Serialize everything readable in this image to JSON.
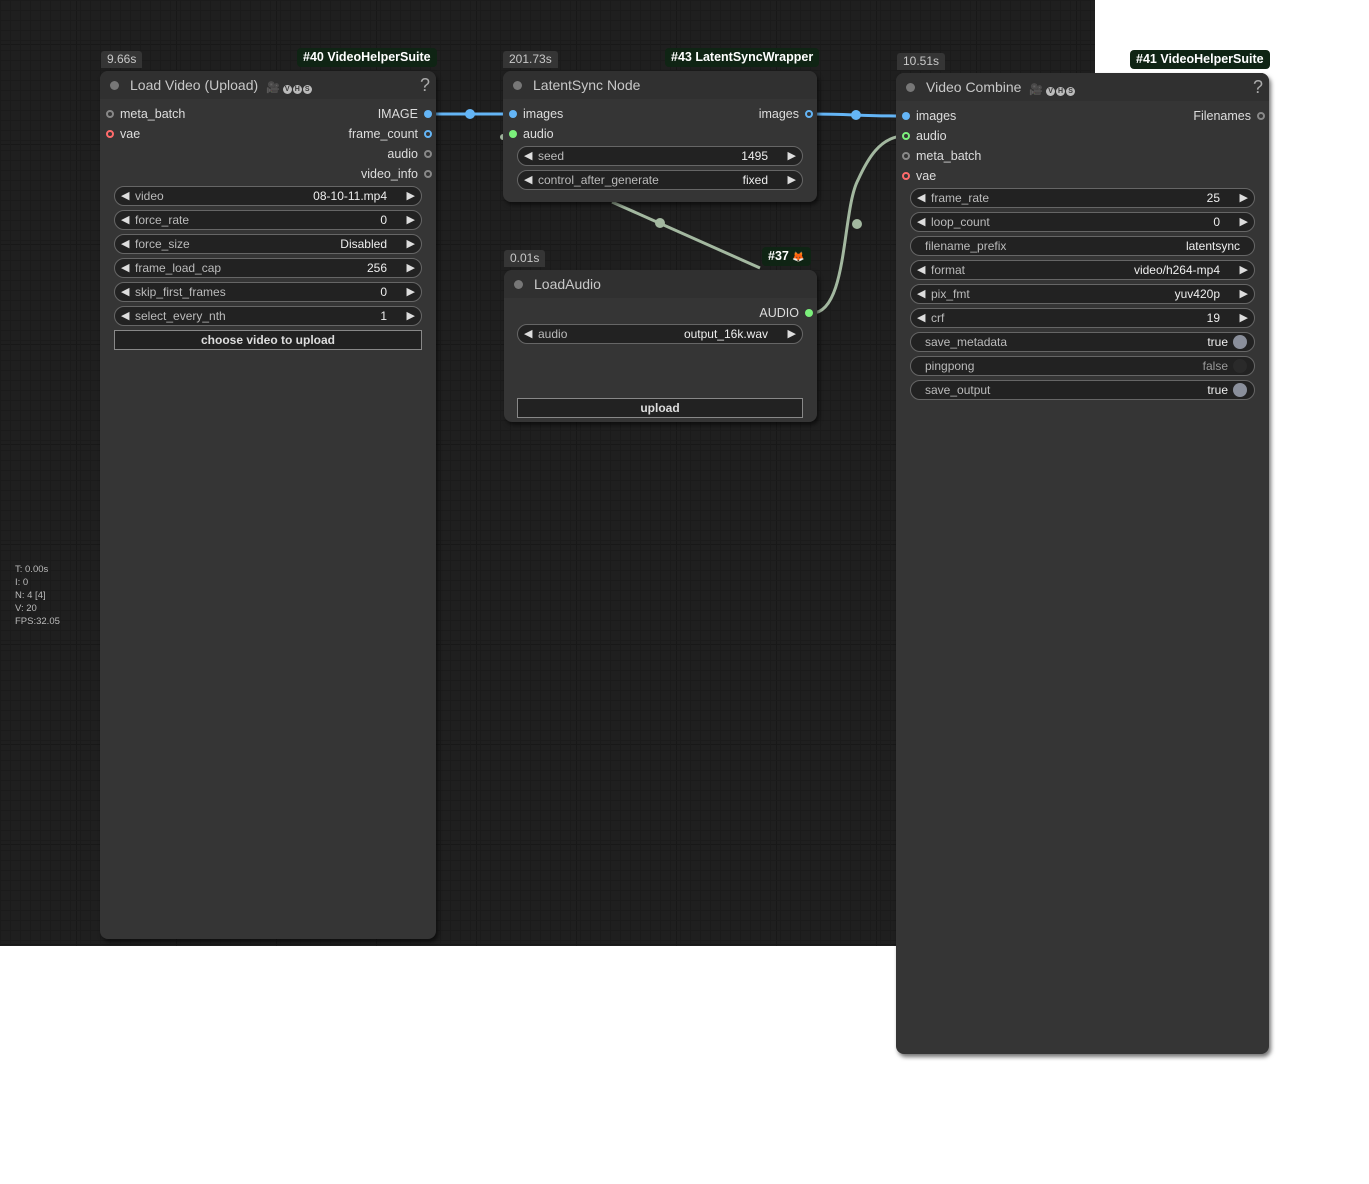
{
  "stats": {
    "t": "T: 0.00s",
    "i": "I: 0",
    "n": "N: 4 [4]",
    "v": "V: 20",
    "fps": "FPS:32.05"
  },
  "nodes": {
    "load_video": {
      "timing": "9.66s",
      "badge": "#40 VideoHelperSuite",
      "title": "Load Video (Upload)",
      "inputs": [
        "meta_batch",
        "vae"
      ],
      "outputs": [
        "IMAGE",
        "frame_count",
        "audio",
        "video_info"
      ],
      "widgets": [
        {
          "label": "video",
          "value": "08-10-11.mp4"
        },
        {
          "label": "force_rate",
          "value": "0"
        },
        {
          "label": "force_size",
          "value": "Disabled"
        },
        {
          "label": "frame_load_cap",
          "value": "256"
        },
        {
          "label": "skip_first_frames",
          "value": "0"
        },
        {
          "label": "select_every_nth",
          "value": "1"
        }
      ],
      "button": "choose video to upload",
      "help": "?"
    },
    "latentsync": {
      "timing": "201.73s",
      "badge": "#43 LatentSyncWrapper",
      "title": "LatentSync Node",
      "inputs": [
        "images",
        "audio"
      ],
      "outputs": [
        "images"
      ],
      "widgets": [
        {
          "label": "seed",
          "value": "1495"
        },
        {
          "label": "control_after_generate",
          "value": "fixed"
        }
      ]
    },
    "load_audio": {
      "timing": "0.01s",
      "badge": "#37",
      "badge_icon": "🦊",
      "title": "LoadAudio",
      "outputs": [
        "AUDIO"
      ],
      "widgets": [
        {
          "label": "audio",
          "value": "output_16k.wav"
        }
      ],
      "button": "upload"
    },
    "video_combine": {
      "timing": "10.51s",
      "badge": "#41 VideoHelperSuite",
      "title": "Video Combine",
      "inputs": [
        "images",
        "audio",
        "meta_batch",
        "vae"
      ],
      "outputs": [
        "Filenames"
      ],
      "widgets": [
        {
          "label": "frame_rate",
          "value": "25"
        },
        {
          "label": "loop_count",
          "value": "0"
        },
        {
          "label": "filename_prefix",
          "value": "latentsync"
        },
        {
          "label": "format",
          "value": "video/h264-mp4"
        },
        {
          "label": "pix_fmt",
          "value": "yuv420p"
        },
        {
          "label": "crf",
          "value": "19"
        },
        {
          "label": "save_metadata",
          "value": "true"
        },
        {
          "label": "pingpong",
          "value": "false"
        },
        {
          "label": "save_output",
          "value": "true"
        }
      ],
      "help": "?"
    }
  },
  "icons": {
    "vhs_letters": [
      "V",
      "H",
      "S"
    ],
    "camera": "🎥"
  },
  "colors": {
    "link_image": "#64b5f6",
    "link_audio": "#a3b8a0",
    "pin_audio": "#7cf07c",
    "pin_vae": "#ff6b6b"
  }
}
